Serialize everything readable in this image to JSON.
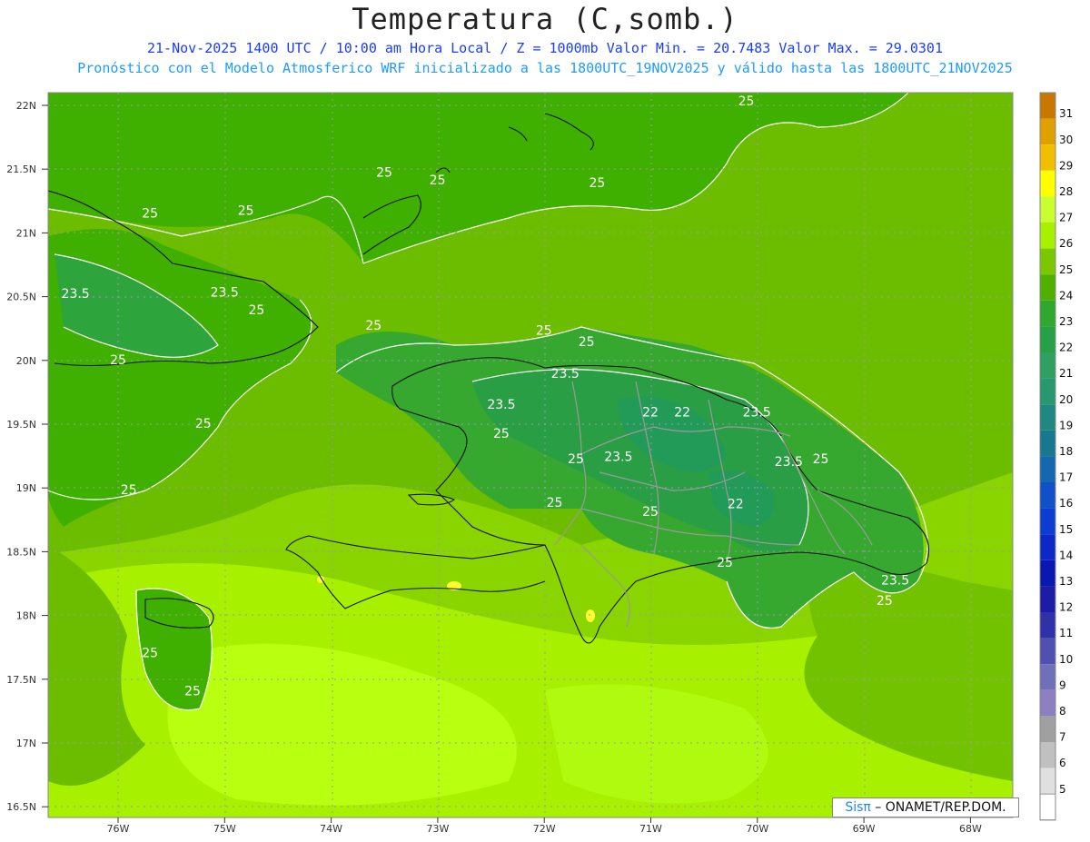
{
  "header": {
    "title": "Temperatura (C,somb.)",
    "subtitle1": "21-Nov-2025 1400 UTC / 10:00 am Hora Local / Z = 1000mb  Valor Min. = 20.7483  Valor Max. = 29.0301",
    "subtitle2": "Pronóstico con el Modelo Atmosferico WRF inicializado a las 1800UTC_19NOV2025 y válido hasta las  1800UTC_21NOV2025"
  },
  "axes": {
    "lat_labels": [
      "22N",
      "21.5N",
      "21N",
      "20.5N",
      "20N",
      "19.5N",
      "19N",
      "18.5N",
      "18N",
      "17.5N",
      "17N",
      "16.5N"
    ],
    "lon_labels": [
      "76W",
      "75W",
      "74W",
      "73W",
      "72W",
      "71W",
      "70W",
      "69W",
      "68W"
    ]
  },
  "colorbar": {
    "labels": [
      "31",
      "30",
      "29",
      "28",
      "27",
      "26",
      "25",
      "24",
      "23",
      "22",
      "21",
      "20",
      "19",
      "18",
      "17",
      "16",
      "15",
      "14",
      "13",
      "12",
      "11",
      "10",
      "9",
      "8",
      "7",
      "6",
      "5"
    ],
    "colors": [
      "#c87800",
      "#e0a000",
      "#f0c000",
      "#ffff00",
      "#c8ff30",
      "#a8f000",
      "#7cc800",
      "#50b000",
      "#30a830",
      "#28a048",
      "#30a060",
      "#289870",
      "#208880",
      "#187890",
      "#1468b0",
      "#1050c8",
      "#0c3cd0",
      "#0c28c8",
      "#0818b0",
      "#1c1ca8",
      "#3030a8",
      "#5050b0",
      "#7070b8",
      "#8c80c0",
      "#a0a0a0",
      "#c0c0c0",
      "#e0e0e0"
    ]
  },
  "contour_labels": [
    {
      "text": "25",
      "lon": -70.1,
      "lat": 22.0
    },
    {
      "text": "25",
      "lon": -73.5,
      "lat": 21.44
    },
    {
      "text": "25",
      "lon": -73.0,
      "lat": 21.38
    },
    {
      "text": "25",
      "lon": -71.5,
      "lat": 21.36
    },
    {
      "text": "25",
      "lon": -75.7,
      "lat": 21.12
    },
    {
      "text": "25",
      "lon": -74.8,
      "lat": 21.14
    },
    {
      "text": "23.5",
      "lon": -76.4,
      "lat": 20.49
    },
    {
      "text": "23.5",
      "lon": -75.0,
      "lat": 20.5
    },
    {
      "text": "25",
      "lon": -74.7,
      "lat": 20.36
    },
    {
      "text": "25",
      "lon": -73.6,
      "lat": 20.24
    },
    {
      "text": "25",
      "lon": -72.0,
      "lat": 20.2
    },
    {
      "text": "25",
      "lon": -71.6,
      "lat": 20.11
    },
    {
      "text": "25",
      "lon": -76.0,
      "lat": 19.97
    },
    {
      "text": "23.5",
      "lon": -71.8,
      "lat": 19.86
    },
    {
      "text": "23.5",
      "lon": -72.4,
      "lat": 19.62
    },
    {
      "text": "22",
      "lon": -71.0,
      "lat": 19.56
    },
    {
      "text": "22",
      "lon": -70.7,
      "lat": 19.56
    },
    {
      "text": "23.5",
      "lon": -70.0,
      "lat": 19.56
    },
    {
      "text": "25",
      "lon": -75.2,
      "lat": 19.47
    },
    {
      "text": "25",
      "lon": -72.4,
      "lat": 19.39
    },
    {
      "text": "25",
      "lon": -71.7,
      "lat": 19.19
    },
    {
      "text": "23.5",
      "lon": -71.3,
      "lat": 19.21
    },
    {
      "text": "23.5",
      "lon": -69.7,
      "lat": 19.17
    },
    {
      "text": "25",
      "lon": -69.4,
      "lat": 19.19
    },
    {
      "text": "25",
      "lon": -75.9,
      "lat": 18.95
    },
    {
      "text": "22",
      "lon": -70.2,
      "lat": 18.84
    },
    {
      "text": "25",
      "lon": -71.9,
      "lat": 18.85
    },
    {
      "text": "25",
      "lon": -71.0,
      "lat": 18.78
    },
    {
      "text": "25",
      "lon": -70.3,
      "lat": 18.38
    },
    {
      "text": "23.5",
      "lon": -68.7,
      "lat": 18.24
    },
    {
      "text": "25",
      "lon": -68.8,
      "lat": 18.08
    },
    {
      "text": "25",
      "lon": -75.7,
      "lat": 17.67
    },
    {
      "text": "25",
      "lon": -75.3,
      "lat": 17.37
    }
  ],
  "footer": {
    "credit_sis": "Sisπ",
    "credit_rest": " – ONAMET/REP.DOM."
  }
}
